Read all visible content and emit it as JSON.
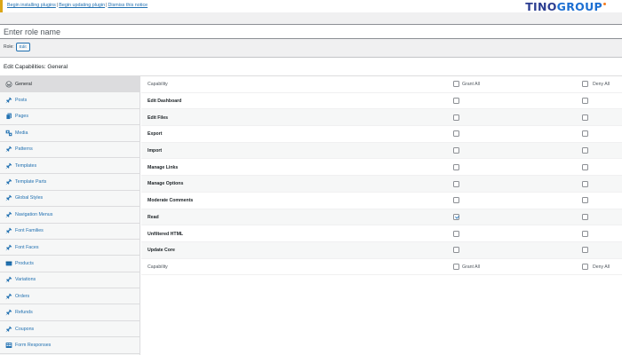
{
  "notice": {
    "links": [
      "Begin installing plugins",
      "Begin updating plugin",
      "Dismiss this notice"
    ],
    "separator": "|"
  },
  "brand": {
    "part1": "TINO",
    "part2": "GROUP"
  },
  "role": {
    "name_placeholder": "Enter role name",
    "label": "Role:",
    "button_label": "Edit"
  },
  "panel_title": "Edit Capabilities: General",
  "tabs": [
    {
      "label": "General",
      "icon": "wordpress-icon",
      "active": true
    },
    {
      "label": "Posts",
      "icon": "pin-icon"
    },
    {
      "label": "Pages",
      "icon": "pages-icon"
    },
    {
      "label": "Media",
      "icon": "media-icon"
    },
    {
      "label": "Patterns",
      "icon": "pin-icon"
    },
    {
      "label": "Templates",
      "icon": "pin-icon"
    },
    {
      "label": "Template Parts",
      "icon": "pin-icon"
    },
    {
      "label": "Global Styles",
      "icon": "pin-icon"
    },
    {
      "label": "Navigation Menus",
      "icon": "pin-icon"
    },
    {
      "label": "Font Families",
      "icon": "pin-icon"
    },
    {
      "label": "Font Faces",
      "icon": "pin-icon"
    },
    {
      "label": "Products",
      "icon": "products-icon"
    },
    {
      "label": "Variations",
      "icon": "pin-icon"
    },
    {
      "label": "Orders",
      "icon": "pin-icon"
    },
    {
      "label": "Refunds",
      "icon": "pin-icon"
    },
    {
      "label": "Coupons",
      "icon": "pin-icon"
    },
    {
      "label": "Form Responses",
      "icon": "form-icon"
    }
  ],
  "capabilities": {
    "column_label": "Capability",
    "grant_all_label": "Grant All",
    "deny_all_label": "Deny All",
    "rows": [
      {
        "name": "Edit Dashboard",
        "grant": false,
        "deny": false
      },
      {
        "name": "Edit Files",
        "grant": false,
        "deny": false
      },
      {
        "name": "Export",
        "grant": false,
        "deny": false
      },
      {
        "name": "Import",
        "grant": false,
        "deny": false
      },
      {
        "name": "Manage Links",
        "grant": false,
        "deny": false
      },
      {
        "name": "Manage Options",
        "grant": false,
        "deny": false
      },
      {
        "name": "Moderate Comments",
        "grant": false,
        "deny": false
      },
      {
        "name": "Read",
        "grant": true,
        "deny": false
      },
      {
        "name": "Unfiltered HTML",
        "grant": false,
        "deny": false
      },
      {
        "name": "Update Core",
        "grant": false,
        "deny": false
      }
    ]
  },
  "colors": {
    "link": "#2271b1",
    "notice_border": "#dba617",
    "brand_primary": "#2b3d91",
    "brand_secondary": "#1c6fd2",
    "brand_dot": "#f47c20"
  }
}
